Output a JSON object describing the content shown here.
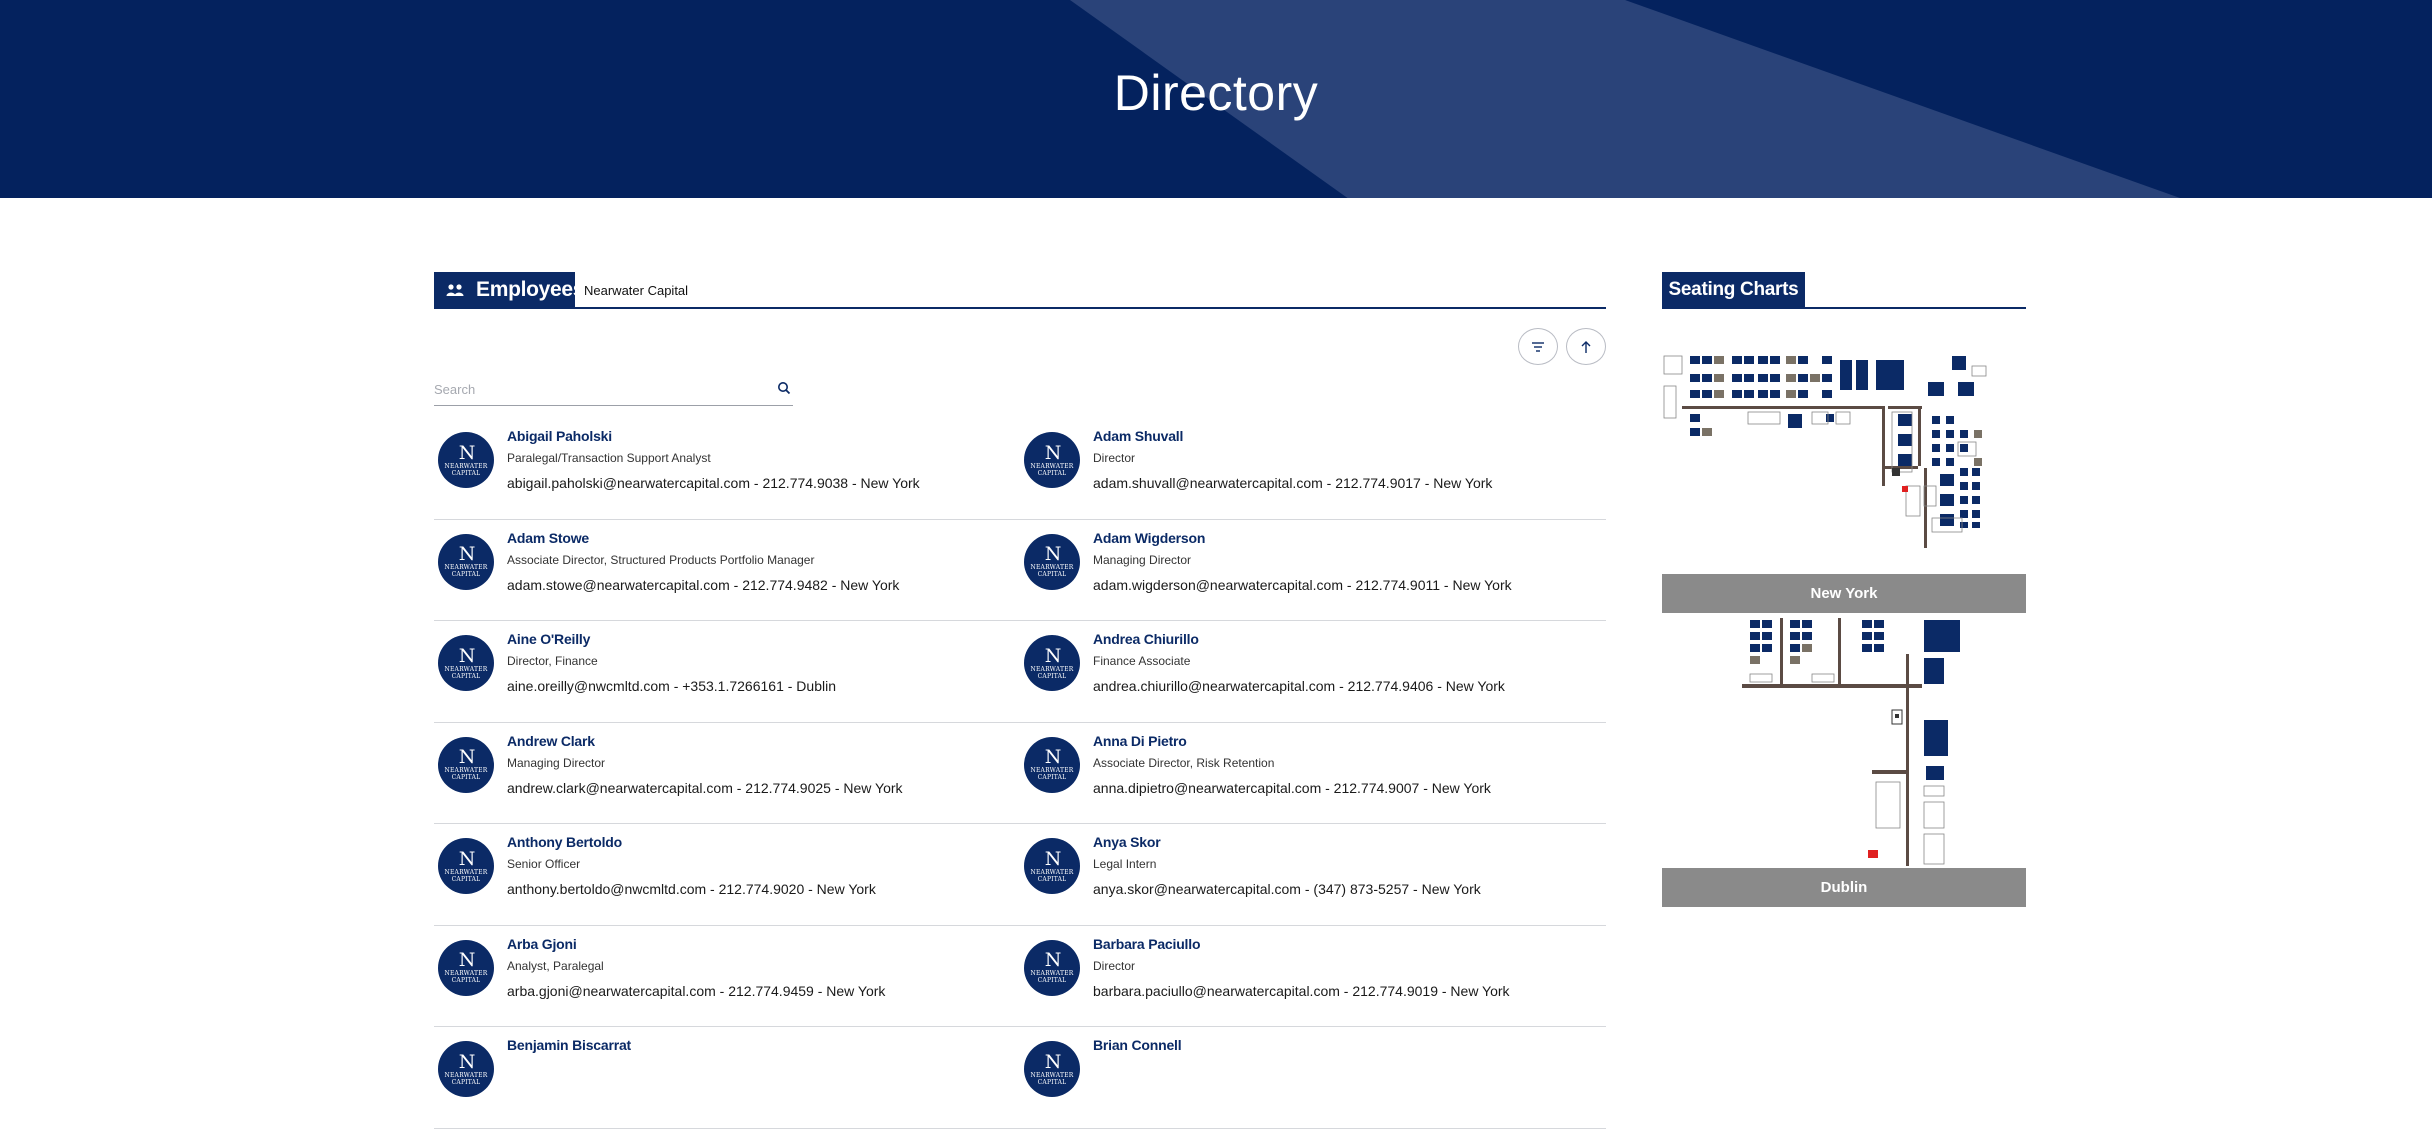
{
  "banner": {
    "title": "Directory"
  },
  "employees": {
    "tab_label": "Employees",
    "company": "Nearwater Capital",
    "search_placeholder": "Search",
    "avatar_monogram": "N",
    "avatar_text": "NEARWATER CAPITAL",
    "rows": [
      [
        {
          "name": "Abigail Paholski",
          "title": "Paralegal/Transaction Support Analyst",
          "contact": "abigail.paholski@nearwatercapital.com - 212.774.9038 - New York"
        },
        {
          "name": "Adam Shuvall",
          "title": "Director",
          "contact": "adam.shuvall@nearwatercapital.com - 212.774.9017 - New York"
        }
      ],
      [
        {
          "name": "Adam Stowe",
          "title": "Associate Director, Structured Products Portfolio Manager",
          "contact": "adam.stowe@nearwatercapital.com - 212.774.9482 - New York"
        },
        {
          "name": "Adam Wigderson",
          "title": "Managing Director",
          "contact": "adam.wigderson@nearwatercapital.com - 212.774.9011 - New York"
        }
      ],
      [
        {
          "name": "Aine O'Reilly",
          "title": "Director, Finance",
          "contact": "aine.oreilly@nwcmltd.com - +353.1.7266161 - Dublin"
        },
        {
          "name": "Andrea Chiurillo",
          "title": "Finance Associate",
          "contact": "andrea.chiurillo@nearwatercapital.com - 212.774.9406 - New York"
        }
      ],
      [
        {
          "name": "Andrew Clark",
          "title": "Managing Director",
          "contact": "andrew.clark@nearwatercapital.com - 212.774.9025 - New York"
        },
        {
          "name": "Anna Di Pietro",
          "title": "Associate Director, Risk Retention",
          "contact": "anna.dipietro@nearwatercapital.com - 212.774.9007 - New York"
        }
      ],
      [
        {
          "name": "Anthony Bertoldo",
          "title": "Senior Officer",
          "contact": "anthony.bertoldo@nwcmltd.com - 212.774.9020 - New York"
        },
        {
          "name": "Anya Skor",
          "title": "Legal Intern",
          "contact": "anya.skor@nearwatercapital.com - (347) 873-5257 - New York"
        }
      ],
      [
        {
          "name": "Arba Gjoni",
          "title": "Analyst, Paralegal",
          "contact": "arba.gjoni@nearwatercapital.com - 212.774.9459 - New York"
        },
        {
          "name": "Barbara Paciullo",
          "title": "Director",
          "contact": "barbara.paciullo@nearwatercapital.com - 212.774.9019 - New York"
        }
      ],
      [
        {
          "name": "Benjamin Biscarrat",
          "title": "",
          "contact": ""
        },
        {
          "name": "Brian Connell",
          "title": "",
          "contact": ""
        }
      ]
    ]
  },
  "seating": {
    "tab_label": "Seating Charts",
    "maps": [
      {
        "label": "New York"
      },
      {
        "label": "Dublin"
      }
    ]
  },
  "colors": {
    "navy": "#0b2a66",
    "banner": "#04225e",
    "stripe": "#274077",
    "map_label_bg": "#8a8a8a"
  },
  "icons": {
    "employees": "people-icon",
    "filter": "filter-icon",
    "sort": "arrow-up-icon",
    "search": "search-icon"
  }
}
